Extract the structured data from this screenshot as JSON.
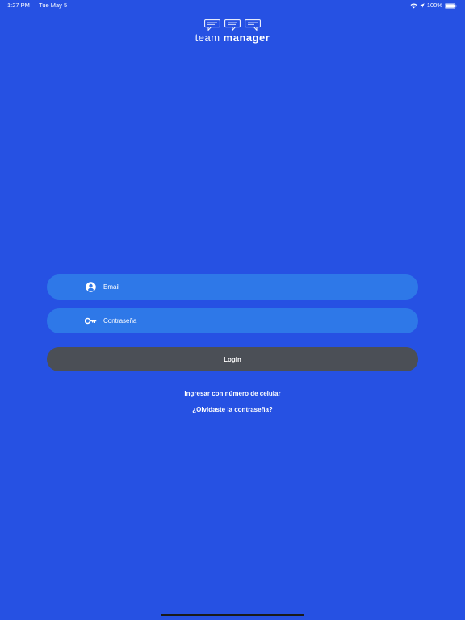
{
  "status_bar": {
    "time": "1:27 PM",
    "date": "Tue May 5",
    "battery": "100%",
    "icons": [
      "wifi-icon",
      "location-icon",
      "battery-icon"
    ]
  },
  "logo": {
    "text_light": "team",
    "text_bold": "manager",
    "icon": "chat-bubbles-icon"
  },
  "form": {
    "email": {
      "placeholder": "Email",
      "value": "",
      "icon": "user-circle-icon"
    },
    "password": {
      "placeholder": "Contraseña",
      "value": "",
      "icon": "key-icon"
    },
    "login_label": "Login"
  },
  "links": {
    "phone_login": "Ingresar con número de celular",
    "forgot_password": "¿Olvidaste la contraseña?"
  },
  "colors": {
    "background": "#2651e3",
    "field": "#2e78e8",
    "button": "#4b4f56",
    "text": "#ffffff"
  }
}
